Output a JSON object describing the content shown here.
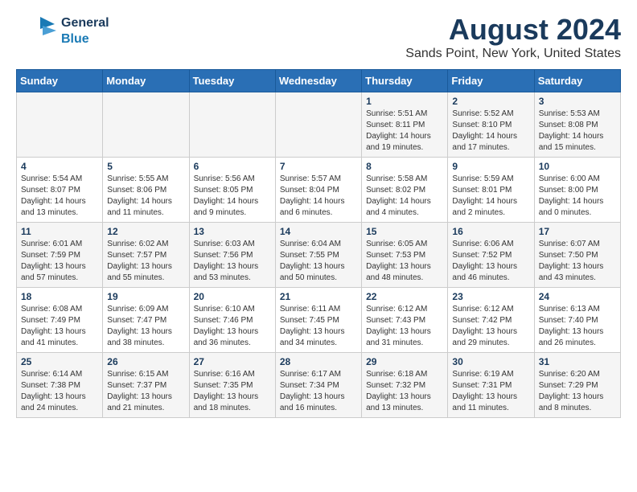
{
  "logo": {
    "line1": "General",
    "line2": "Blue"
  },
  "title": "August 2024",
  "subtitle": "Sands Point, New York, United States",
  "days_of_week": [
    "Sunday",
    "Monday",
    "Tuesday",
    "Wednesday",
    "Thursday",
    "Friday",
    "Saturday"
  ],
  "weeks": [
    [
      {
        "num": "",
        "info": ""
      },
      {
        "num": "",
        "info": ""
      },
      {
        "num": "",
        "info": ""
      },
      {
        "num": "",
        "info": ""
      },
      {
        "num": "1",
        "info": "Sunrise: 5:51 AM\nSunset: 8:11 PM\nDaylight: 14 hours\nand 19 minutes."
      },
      {
        "num": "2",
        "info": "Sunrise: 5:52 AM\nSunset: 8:10 PM\nDaylight: 14 hours\nand 17 minutes."
      },
      {
        "num": "3",
        "info": "Sunrise: 5:53 AM\nSunset: 8:08 PM\nDaylight: 14 hours\nand 15 minutes."
      }
    ],
    [
      {
        "num": "4",
        "info": "Sunrise: 5:54 AM\nSunset: 8:07 PM\nDaylight: 14 hours\nand 13 minutes."
      },
      {
        "num": "5",
        "info": "Sunrise: 5:55 AM\nSunset: 8:06 PM\nDaylight: 14 hours\nand 11 minutes."
      },
      {
        "num": "6",
        "info": "Sunrise: 5:56 AM\nSunset: 8:05 PM\nDaylight: 14 hours\nand 9 minutes."
      },
      {
        "num": "7",
        "info": "Sunrise: 5:57 AM\nSunset: 8:04 PM\nDaylight: 14 hours\nand 6 minutes."
      },
      {
        "num": "8",
        "info": "Sunrise: 5:58 AM\nSunset: 8:02 PM\nDaylight: 14 hours\nand 4 minutes."
      },
      {
        "num": "9",
        "info": "Sunrise: 5:59 AM\nSunset: 8:01 PM\nDaylight: 14 hours\nand 2 minutes."
      },
      {
        "num": "10",
        "info": "Sunrise: 6:00 AM\nSunset: 8:00 PM\nDaylight: 14 hours\nand 0 minutes."
      }
    ],
    [
      {
        "num": "11",
        "info": "Sunrise: 6:01 AM\nSunset: 7:59 PM\nDaylight: 13 hours\nand 57 minutes."
      },
      {
        "num": "12",
        "info": "Sunrise: 6:02 AM\nSunset: 7:57 PM\nDaylight: 13 hours\nand 55 minutes."
      },
      {
        "num": "13",
        "info": "Sunrise: 6:03 AM\nSunset: 7:56 PM\nDaylight: 13 hours\nand 53 minutes."
      },
      {
        "num": "14",
        "info": "Sunrise: 6:04 AM\nSunset: 7:55 PM\nDaylight: 13 hours\nand 50 minutes."
      },
      {
        "num": "15",
        "info": "Sunrise: 6:05 AM\nSunset: 7:53 PM\nDaylight: 13 hours\nand 48 minutes."
      },
      {
        "num": "16",
        "info": "Sunrise: 6:06 AM\nSunset: 7:52 PM\nDaylight: 13 hours\nand 46 minutes."
      },
      {
        "num": "17",
        "info": "Sunrise: 6:07 AM\nSunset: 7:50 PM\nDaylight: 13 hours\nand 43 minutes."
      }
    ],
    [
      {
        "num": "18",
        "info": "Sunrise: 6:08 AM\nSunset: 7:49 PM\nDaylight: 13 hours\nand 41 minutes."
      },
      {
        "num": "19",
        "info": "Sunrise: 6:09 AM\nSunset: 7:47 PM\nDaylight: 13 hours\nand 38 minutes."
      },
      {
        "num": "20",
        "info": "Sunrise: 6:10 AM\nSunset: 7:46 PM\nDaylight: 13 hours\nand 36 minutes."
      },
      {
        "num": "21",
        "info": "Sunrise: 6:11 AM\nSunset: 7:45 PM\nDaylight: 13 hours\nand 34 minutes."
      },
      {
        "num": "22",
        "info": "Sunrise: 6:12 AM\nSunset: 7:43 PM\nDaylight: 13 hours\nand 31 minutes."
      },
      {
        "num": "23",
        "info": "Sunrise: 6:12 AM\nSunset: 7:42 PM\nDaylight: 13 hours\nand 29 minutes."
      },
      {
        "num": "24",
        "info": "Sunrise: 6:13 AM\nSunset: 7:40 PM\nDaylight: 13 hours\nand 26 minutes."
      }
    ],
    [
      {
        "num": "25",
        "info": "Sunrise: 6:14 AM\nSunset: 7:38 PM\nDaylight: 13 hours\nand 24 minutes."
      },
      {
        "num": "26",
        "info": "Sunrise: 6:15 AM\nSunset: 7:37 PM\nDaylight: 13 hours\nand 21 minutes."
      },
      {
        "num": "27",
        "info": "Sunrise: 6:16 AM\nSunset: 7:35 PM\nDaylight: 13 hours\nand 18 minutes."
      },
      {
        "num": "28",
        "info": "Sunrise: 6:17 AM\nSunset: 7:34 PM\nDaylight: 13 hours\nand 16 minutes."
      },
      {
        "num": "29",
        "info": "Sunrise: 6:18 AM\nSunset: 7:32 PM\nDaylight: 13 hours\nand 13 minutes."
      },
      {
        "num": "30",
        "info": "Sunrise: 6:19 AM\nSunset: 7:31 PM\nDaylight: 13 hours\nand 11 minutes."
      },
      {
        "num": "31",
        "info": "Sunrise: 6:20 AM\nSunset: 7:29 PM\nDaylight: 13 hours\nand 8 minutes."
      }
    ]
  ]
}
